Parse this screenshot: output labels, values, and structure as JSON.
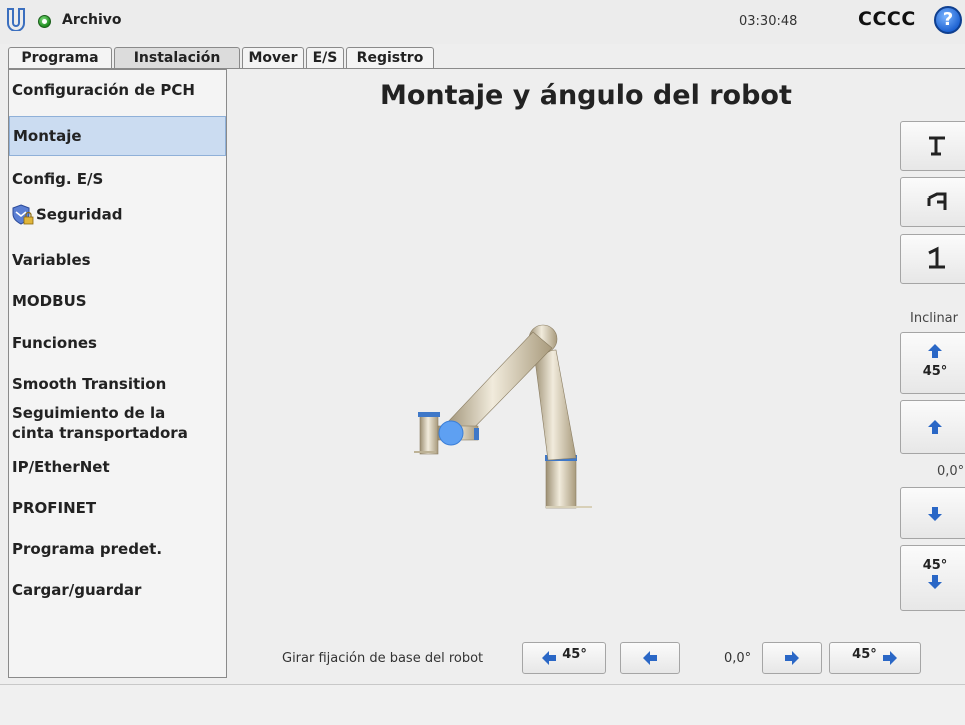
{
  "header": {
    "file_title": "Archivo",
    "clock": "03:30:48",
    "robot_name": "CCCC",
    "help_glyph": "?",
    "status_color": "#2ea62e"
  },
  "tabs": [
    {
      "label": "Programa"
    },
    {
      "label": "Instalación",
      "active": true
    },
    {
      "label": "Mover"
    },
    {
      "label": "E/S"
    },
    {
      "label": "Registro"
    }
  ],
  "sidebar": {
    "items": [
      {
        "label": "Configuración de PCH"
      },
      {
        "label": "Montaje",
        "selected": true
      },
      {
        "label": "Config. E/S"
      },
      {
        "label": "Seguridad",
        "icon": "shield-lock-icon"
      },
      {
        "label": "Variables"
      },
      {
        "label": "MODBUS"
      },
      {
        "label": "Funciones"
      },
      {
        "label": "Smooth Transition"
      },
      {
        "label": "Seguimiento de la",
        "label2": "cinta transportadora"
      },
      {
        "label": "IP/EtherNet"
      },
      {
        "label": "PROFINET"
      },
      {
        "label": "Programa predet."
      },
      {
        "label": "Cargar/guardar"
      }
    ]
  },
  "main": {
    "title": "Montaje y ángulo del robot",
    "tilt": {
      "label": "Inclinar",
      "step_label": "45°",
      "value": "0,0°"
    },
    "rotate": {
      "label": "Girar fijación de base del robot",
      "step_label": "45°",
      "value": "0,0°"
    }
  },
  "colors": {
    "accent": "#2a67c6",
    "selected_bg": "#cbdcf1"
  }
}
